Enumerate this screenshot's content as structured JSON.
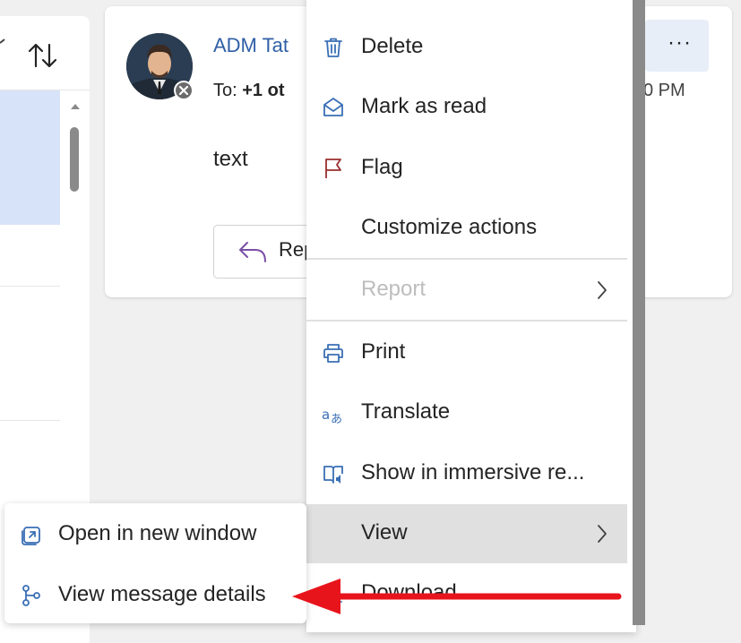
{
  "message": {
    "sender_name": "ADM Tat",
    "to_prefix": "To:",
    "to_recipients": "+1 ot",
    "time_fragment": "0 PM",
    "body_text": "text",
    "reply_label": "Rep",
    "more_actions": "···"
  },
  "menu": {
    "items": [
      {
        "label": "Delete",
        "icon": "trash-icon"
      },
      {
        "label": "Mark as read",
        "icon": "envelope-open-icon"
      },
      {
        "label": "Flag",
        "icon": "flag-icon"
      },
      {
        "label": "Customize actions",
        "icon": ""
      },
      {
        "label": "Report",
        "icon": "",
        "disabled": true
      },
      {
        "label": "Print",
        "icon": "printer-icon"
      },
      {
        "label": "Translate",
        "icon": "translate-icon"
      },
      {
        "label": "Show in immersive re...",
        "icon": "immersive-reader-icon"
      },
      {
        "label": "View",
        "icon": ""
      },
      {
        "label": "Download",
        "icon": "download-icon"
      }
    ]
  },
  "submenu": {
    "items": [
      {
        "label": "Open in new window",
        "icon": "open-new-window-icon"
      },
      {
        "label": "View message details",
        "icon": "message-details-icon"
      }
    ]
  },
  "colors": {
    "accent_blue": "#2f5fa7",
    "selected_row": "#d7e3f8",
    "highlight_menu": "#e0e0e0",
    "annotation_red": "#e8141c",
    "icon_blue": "#3a6fb5"
  }
}
